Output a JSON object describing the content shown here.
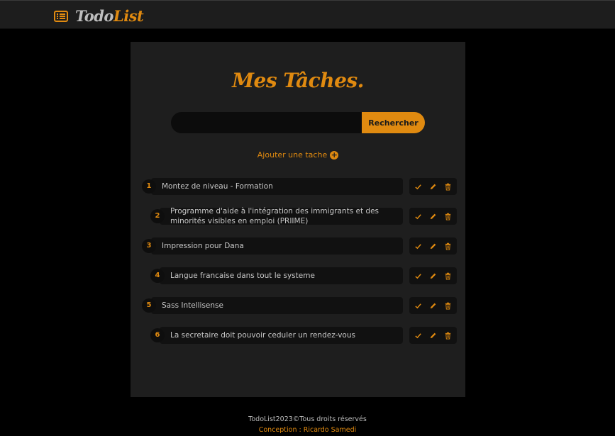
{
  "brand": {
    "text_a": "Todo",
    "text_b": "List",
    "accent": "#e08a10",
    "icon": "list-alt-icon"
  },
  "title": "Mes Tâches.",
  "search": {
    "value": "",
    "placeholder": "",
    "button_label": "Rechercher"
  },
  "add": {
    "label": "Ajouter une tache",
    "icon": "plus-circle-icon"
  },
  "tasks": [
    {
      "num": "1",
      "text": "Montez de niveau - Formation"
    },
    {
      "num": "2",
      "text": "Programme d'aide à l'intégration des immigrants et des minorités visibles en emploi (PRIIME)"
    },
    {
      "num": "3",
      "text": "Impression pour Dana"
    },
    {
      "num": "4",
      "text": "Langue francaise dans tout le systeme"
    },
    {
      "num": "5",
      "text": "Sass Intellisense"
    },
    {
      "num": "6",
      "text": "La secretaire doit pouvoir ceduler un rendez-vous"
    }
  ],
  "task_action_icons": [
    "check-icon",
    "pencil-icon",
    "trash-icon"
  ],
  "footer": {
    "line1": "TodoList2023©Tous droits réservés",
    "line2": "Conception : Ricardo Samedi"
  }
}
